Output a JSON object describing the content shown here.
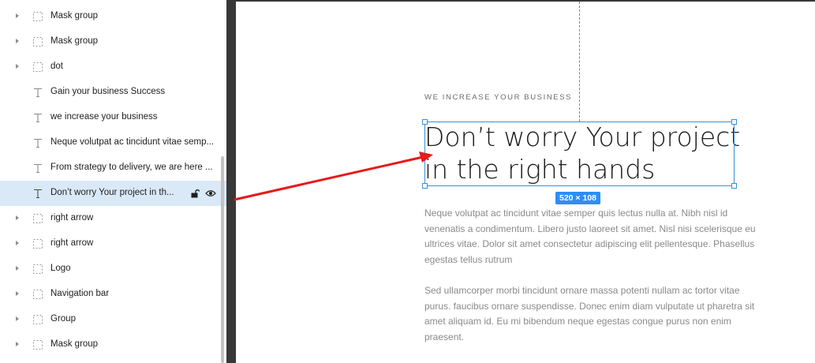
{
  "layers_panel": {
    "items": [
      {
        "label": "Mask group",
        "type": "group",
        "expandable": true
      },
      {
        "label": "Mask group",
        "type": "group",
        "expandable": true
      },
      {
        "label": "dot",
        "type": "group",
        "expandable": true
      },
      {
        "label": "Gain your business Success",
        "type": "text",
        "expandable": false
      },
      {
        "label": "we increase your business",
        "type": "text",
        "expandable": false
      },
      {
        "label": "Neque volutpat ac tincidunt vitae semp...",
        "type": "text",
        "expandable": false
      },
      {
        "label": "From strategy to delivery, we are here ...",
        "type": "text",
        "expandable": false
      },
      {
        "label": "Don’t worry Your project in th...",
        "type": "text",
        "expandable": false,
        "selected": true
      },
      {
        "label": "right arrow",
        "type": "group",
        "expandable": true
      },
      {
        "label": "right arrow",
        "type": "group",
        "expandable": true
      },
      {
        "label": "Logo",
        "type": "group",
        "expandable": true
      },
      {
        "label": "Navigation bar",
        "type": "group",
        "expandable": true
      },
      {
        "label": "Group",
        "type": "group",
        "expandable": true
      },
      {
        "label": "Mask group",
        "type": "group",
        "expandable": true
      }
    ]
  },
  "canvas": {
    "eyebrow": "WE INCREASE YOUR BUSINESS",
    "headline_line1": "Don’t worry Your project",
    "headline_line2": "in the right hands",
    "paragraph1": "Neque volutpat ac tincidunt vitae semper quis lectus nulla at. Nibh nisl id venenatis a condimentum. Libero justo laoreet sit amet. Nisl nisi scelerisque eu ultrices vitae. Dolor sit amet consectetur adipiscing elit pellentesque. Phasellus egestas tellus rutrum",
    "paragraph2": "Sed ullamcorper morbi tincidunt ornare massa potenti nullam ac tortor vitae purus. faucibus ornare suspendisse. Donec enim diam vulputate ut pharetra sit amet aliquam id. Eu mi bibendum neque egestas congue purus non enim praesent.",
    "selection_size": "520 × 108"
  },
  "colors": {
    "selection_accent": "#3a8fd6",
    "badge_bg": "#2c8ef8",
    "annotation_arrow": "#e8181b",
    "selected_row_bg": "#dae9f7"
  }
}
